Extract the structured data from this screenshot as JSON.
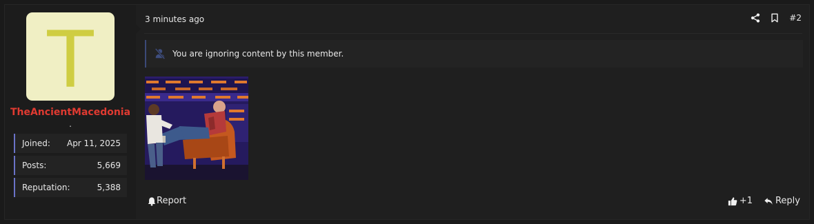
{
  "user": {
    "avatar_letter": "T",
    "username": "TheAncientMacedonia",
    "title": ".",
    "stats": [
      {
        "label": "Joined:",
        "value": "Apr 11, 2025"
      },
      {
        "label": "Posts:",
        "value": "5,669"
      },
      {
        "label": "Reputation:",
        "value": "5,388"
      }
    ]
  },
  "post": {
    "time": "3 minutes ago",
    "number": "#2",
    "ignored_notice": "You are ignoring content by this member.",
    "attachment": "animated GIF"
  },
  "footer": {
    "report_label": "Report",
    "reaction_count": "+1",
    "reply_label": "Reply"
  },
  "colors": {
    "username": "#e03a31",
    "avatar_bg": "#f0efc4",
    "avatar_letter": "#cfcd42",
    "stat_accent": "#6a73c8"
  },
  "icons": [
    "share-icon",
    "bookmark-icon",
    "muted-user-icon",
    "bell-icon",
    "thumbs-up-icon",
    "reply-icon"
  ]
}
